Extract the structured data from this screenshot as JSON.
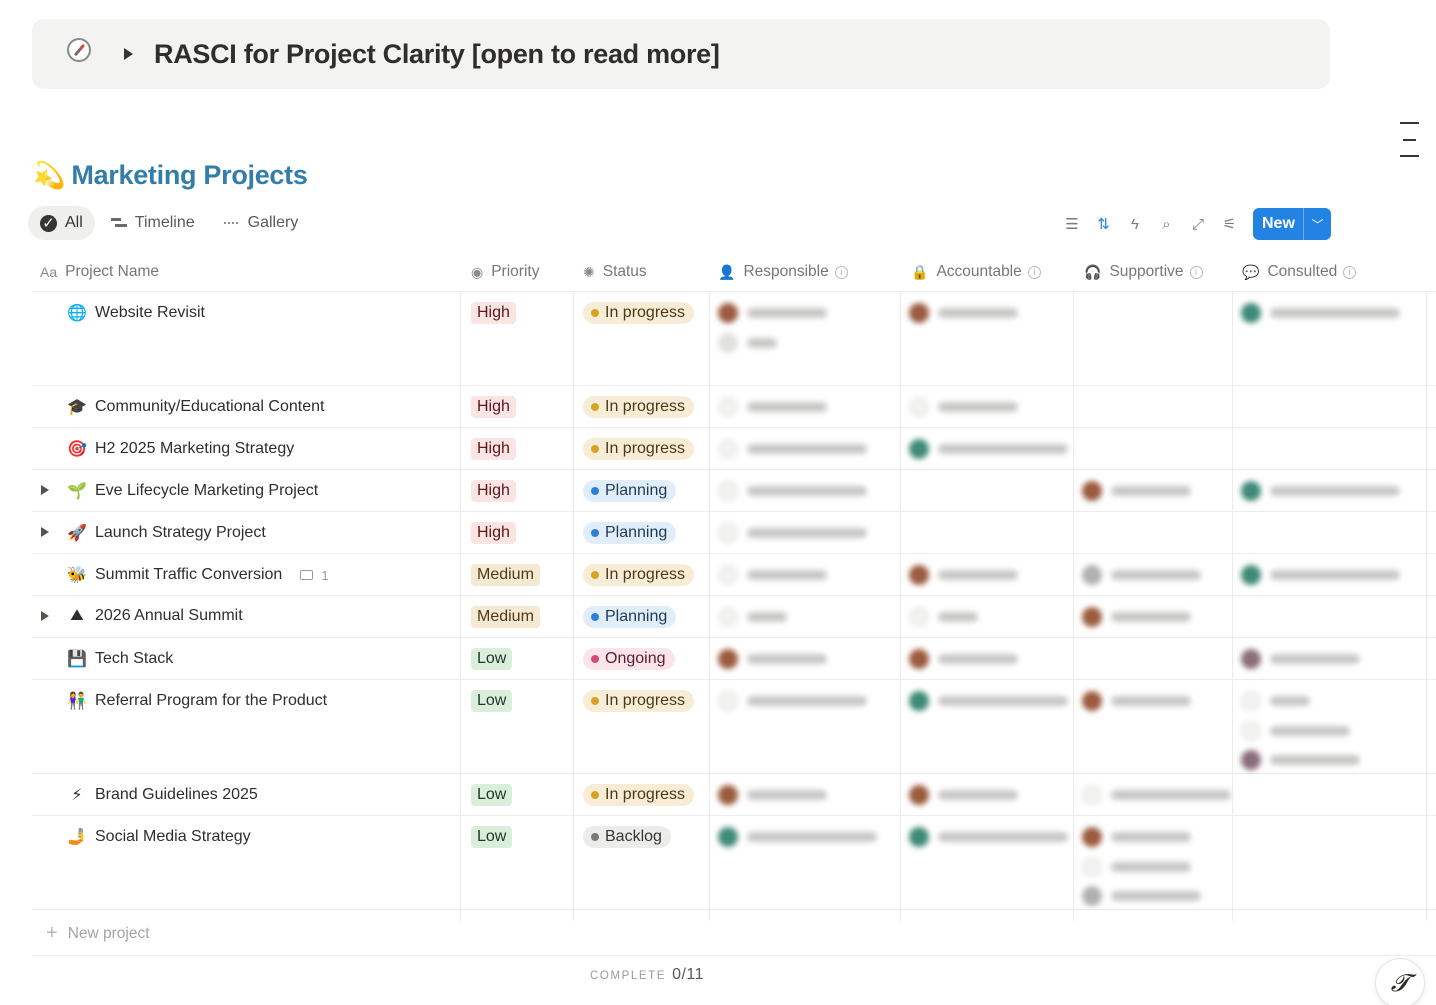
{
  "callout": {
    "title": "RASCI for Project Clarity [open to read more]",
    "icon": "compass-icon"
  },
  "database": {
    "title": "Marketing Projects",
    "icon": "comet-icon"
  },
  "views": [
    {
      "label": "All",
      "icon": "all-icon",
      "active": true
    },
    {
      "label": "Timeline",
      "icon": "timeline-icon",
      "active": false
    },
    {
      "label": "Gallery",
      "icon": "gallery-icon",
      "active": false
    }
  ],
  "toolbar": {
    "new_label": "New"
  },
  "columns": {
    "name": "Project Name",
    "priority": "Priority",
    "status": "Status",
    "responsible": "Responsible",
    "accountable": "Accountable",
    "supportive": "Supportive",
    "consulted": "Consulted"
  },
  "rows": [
    {
      "name": "Website Revisit",
      "emoji": "🌐",
      "toggle": false,
      "priority": "High",
      "status": "In progress"
    },
    {
      "name": "Community/Educational Content",
      "emoji": "🎓",
      "toggle": false,
      "priority": "High",
      "status": "In progress"
    },
    {
      "name": "H2 2025 Marketing Strategy",
      "emoji": "🎯",
      "toggle": false,
      "priority": "High",
      "status": "In progress"
    },
    {
      "name": "Eve Lifecycle Marketing Project",
      "emoji": "🌱",
      "toggle": true,
      "priority": "High",
      "status": "Planning"
    },
    {
      "name": "Launch Strategy Project",
      "emoji": "🚀",
      "toggle": true,
      "priority": "High",
      "status": "Planning"
    },
    {
      "name": "Summit Traffic Conversion",
      "emoji": "🐝",
      "toggle": false,
      "priority": "Medium",
      "status": "In progress",
      "comments": "1"
    },
    {
      "name": "2026 Annual Summit",
      "emoji": "⛰",
      "toggle": true,
      "priority": "Medium",
      "status": "Planning"
    },
    {
      "name": "Tech Stack",
      "emoji": "💾",
      "toggle": false,
      "priority": "Low",
      "status": "Ongoing"
    },
    {
      "name": "Referral Program for the Product",
      "emoji": "👫",
      "toggle": false,
      "priority": "Low",
      "status": "In progress"
    },
    {
      "name": "Brand Guidelines 2025",
      "emoji": "⚡",
      "toggle": false,
      "priority": "Low",
      "status": "In progress"
    },
    {
      "name": "Social Media Strategy",
      "emoji": "🤳",
      "toggle": false,
      "priority": "Low",
      "status": "Backlog"
    }
  ],
  "new_row_label": "New project",
  "footer": {
    "label": "COMPLETE",
    "value": "0/11"
  }
}
